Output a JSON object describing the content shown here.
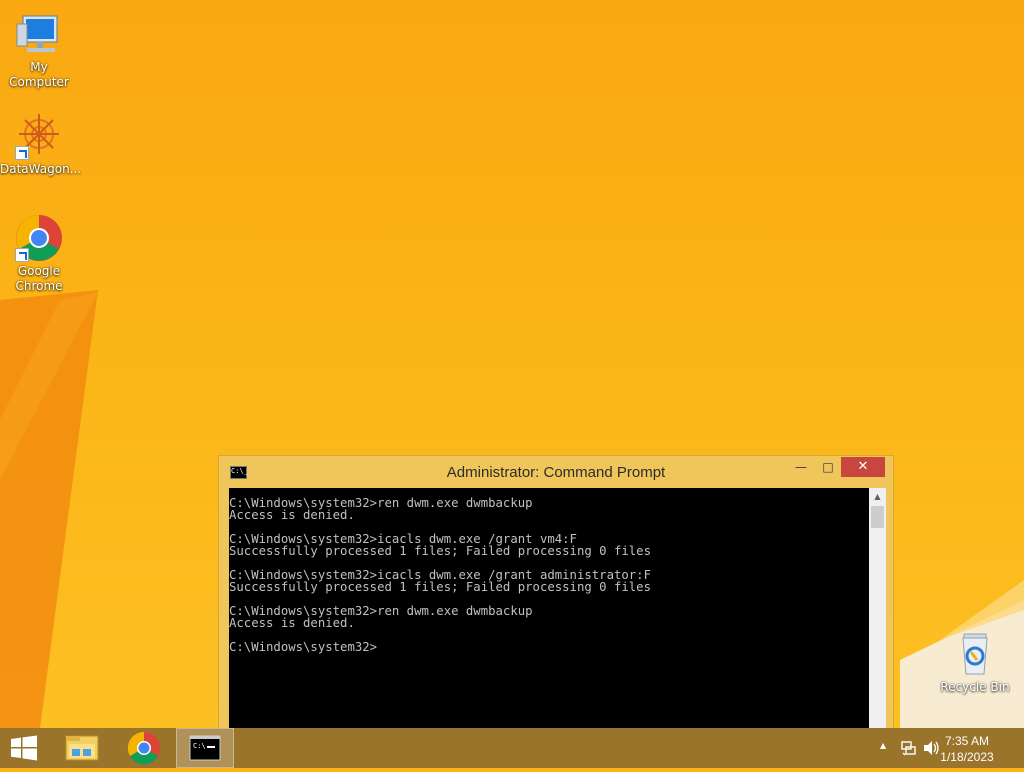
{
  "desktop": {
    "icons": [
      {
        "label": "My Computer",
        "icon": "my-computer-icon"
      },
      {
        "label": "DataWagon...",
        "icon": "datawagon-icon"
      },
      {
        "label": "Google Chrome",
        "icon": "chrome-icon"
      },
      {
        "label": "Recycle Bin",
        "icon": "recycle-bin-icon"
      }
    ]
  },
  "cmd_window": {
    "title": "Administrator:  Command Prompt",
    "icon_glyph": "C:\\_",
    "minimize_glyph": "—",
    "maximize_glyph": "□",
    "close_glyph": "✕",
    "console_lines": [
      "C:\\Windows\\system32>ren dwm.exe dwmbackup",
      "Access is denied.",
      "",
      "C:\\Windows\\system32>icacls dwm.exe /grant vm4:F",
      "Successfully processed 1 files; Failed processing 0 files",
      "",
      "C:\\Windows\\system32>icacls dwm.exe /grant administrator:F",
      "Successfully processed 1 files; Failed processing 0 files",
      "",
      "C:\\Windows\\system32>ren dwm.exe dwmbackup",
      "Access is denied.",
      "",
      "C:\\Windows\\system32>"
    ],
    "scroll_up_glyph": "▲"
  },
  "taskbar": {
    "items": [
      {
        "name": "start",
        "icon": "windows-logo-icon"
      },
      {
        "name": "file-explorer",
        "icon": "folder-icon"
      },
      {
        "name": "chrome",
        "icon": "chrome-icon"
      },
      {
        "name": "command-prompt",
        "icon": "cmd-icon",
        "active": true
      }
    ],
    "tray": {
      "chevron_glyph": "▲",
      "time": "7:35 AM",
      "date": "1/18/2023"
    }
  },
  "colors": {
    "desktop_bg": "#fbb414",
    "taskbar_bg": "#9a742a",
    "window_frame": "#f0c65a",
    "close_button": "#c7463d",
    "console_bg": "#000000",
    "console_text": "#c0c0c0"
  }
}
